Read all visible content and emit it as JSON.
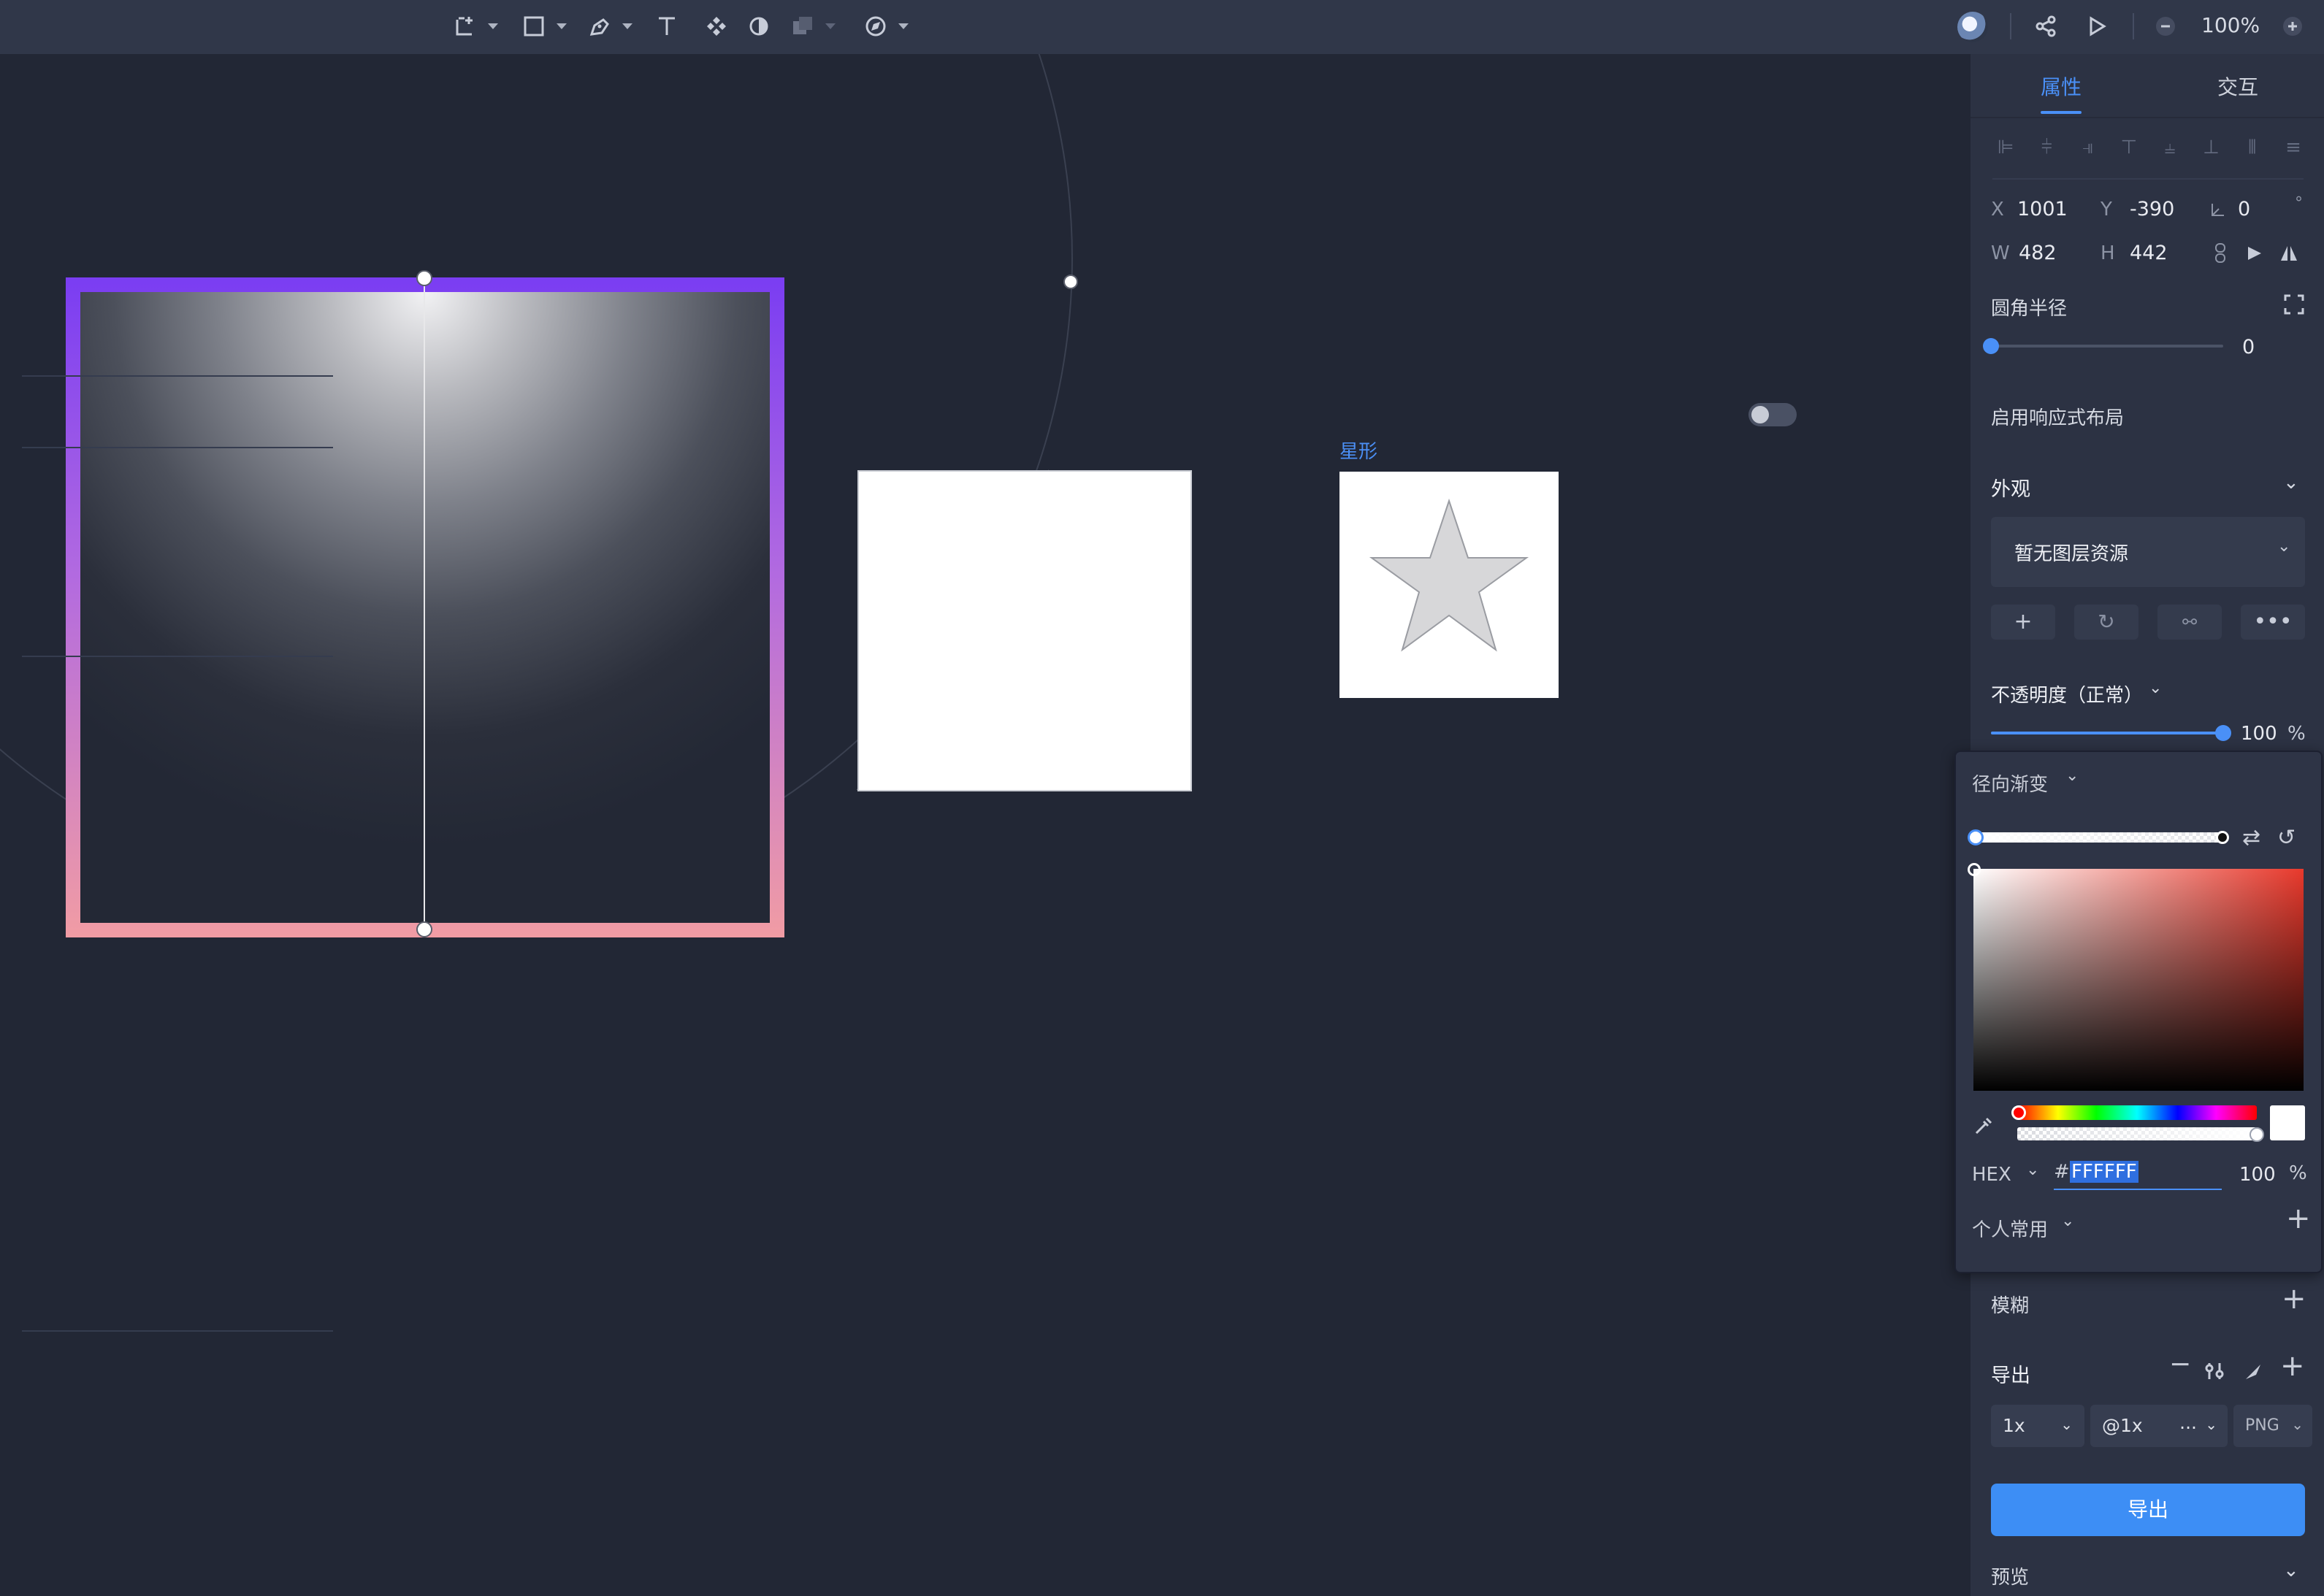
{
  "toolbar": {
    "zoom": "100%",
    "tools": [
      "frame-tool",
      "rectangle-tool",
      "pen-tool",
      "text-tool",
      "component-tool",
      "mask-tool",
      "boolean-tool",
      "plugin-tool"
    ],
    "right_icons": [
      "avatar",
      "share-icon",
      "play-icon",
      "zoom-out-icon",
      "zoom-in-icon"
    ]
  },
  "canvas": {
    "star_label": "星形",
    "colors": {
      "frame_top": "#7a3df2",
      "frame_bottom": "#f19ca4",
      "label": "#4b8ff5"
    }
  },
  "panel": {
    "tabs": {
      "properties": "属性",
      "interaction": "交互"
    },
    "geometry": {
      "x_label": "X",
      "x_value": "1001",
      "y_label": "Y",
      "y_value": "-390",
      "angle_value": "0",
      "angle_unit": "°",
      "w_label": "W",
      "w_value": "482",
      "h_label": "H",
      "h_value": "442"
    },
    "corner_radius": {
      "label": "圆角半径",
      "value": "0",
      "level": 0
    },
    "responsive": {
      "label": "启用响应式布局",
      "enabled": false
    },
    "appearance": {
      "title": "外观",
      "resource_placeholder": "暂无图层资源"
    },
    "opacity": {
      "label": "不透明度（正常）",
      "value": "100",
      "unit": "%",
      "level": 1.0
    },
    "blur": {
      "label": "模糊"
    },
    "export": {
      "title": "导出",
      "scale": "1x",
      "suffix": "@1x",
      "suffix_more": "...",
      "format": "PNG",
      "button_label": "导出"
    },
    "preview": {
      "label": "预览"
    }
  },
  "color_picker": {
    "mode": "径向渐变",
    "hex_label": "HEX",
    "hash": "#",
    "hex_value": "FFFFFF",
    "alpha_value": "100",
    "alpha_unit": "%",
    "favorites_label": "个人常用",
    "accent": "#4a90f7"
  }
}
